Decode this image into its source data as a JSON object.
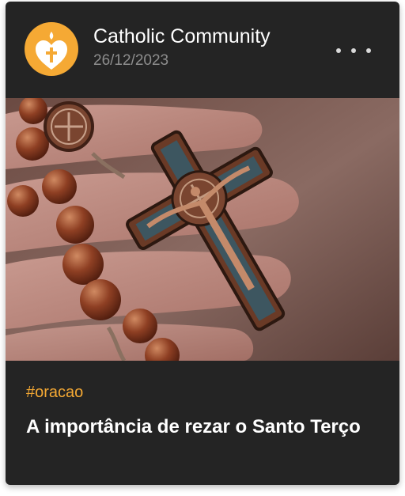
{
  "post": {
    "community_name": "Catholic Community",
    "date": "26/12/2023",
    "more_icon": "more-dots-icon",
    "avatar_icon": "sacred-heart-icon",
    "image_alt": "Rosário com crucifixo de São Bento segurado na mão",
    "tag": "#oracao",
    "title": "A importância de rezar o Santo Terço"
  },
  "colors": {
    "card_background": "#242424",
    "accent": "#f5a934",
    "text_primary": "#ffffff",
    "text_secondary": "#8d8d8d"
  }
}
